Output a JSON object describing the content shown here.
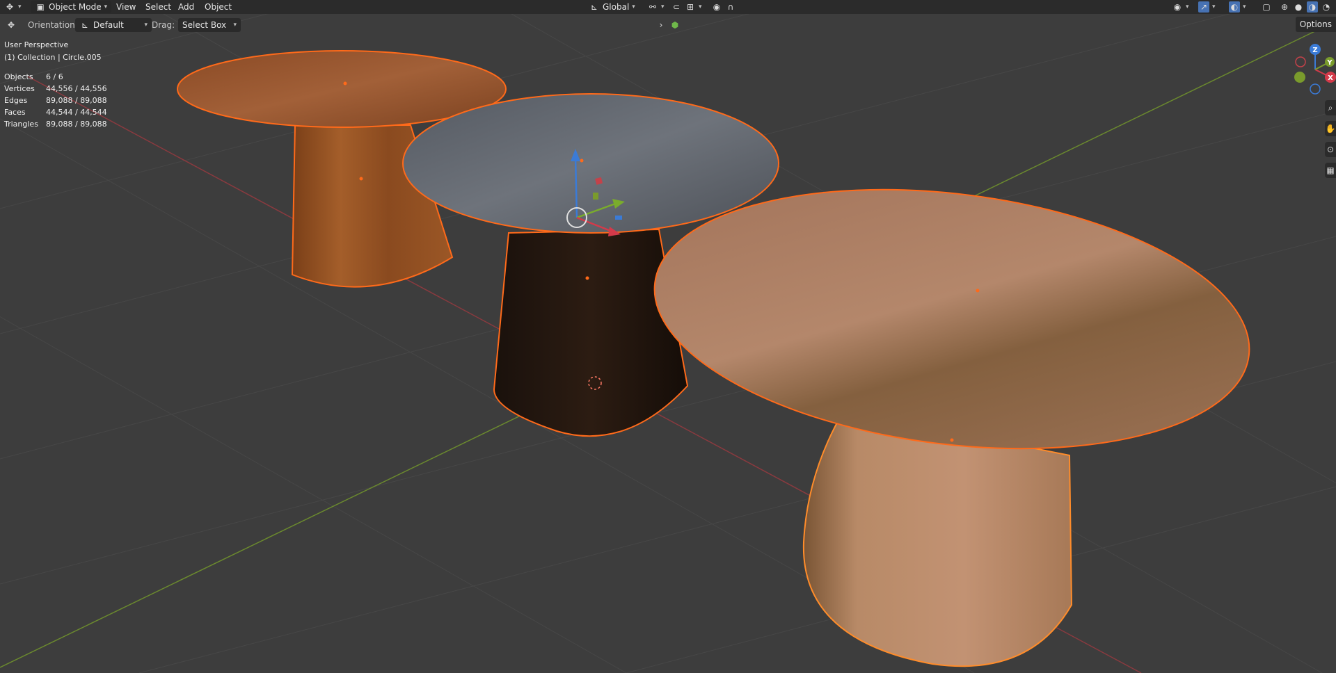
{
  "header": {
    "editor_icon": "move-icon",
    "mode_label": "Object Mode",
    "menus": [
      "View",
      "Select",
      "Add",
      "Object"
    ],
    "transform_orientation": "Global"
  },
  "toolbar": {
    "orientation_label": "Orientation:",
    "orientation_value": "Default",
    "drag_label": "Drag:",
    "drag_value": "Select Box",
    "options_label": "Options"
  },
  "viewport": {
    "perspective": "User Perspective",
    "collection": "(1) Collection | Circle.005",
    "stats": [
      {
        "key": "Objects",
        "value": "6 / 6"
      },
      {
        "key": "Vertices",
        "value": "44,556 / 44,556"
      },
      {
        "key": "Edges",
        "value": "89,088 / 89,088"
      },
      {
        "key": "Faces",
        "value": "44,544 / 44,544"
      },
      {
        "key": "Triangles",
        "value": "89,088 / 89,088"
      }
    ]
  },
  "gizmo": {
    "x": "X",
    "y": "Y",
    "z": "Z"
  },
  "colors": {
    "selection_outline": "#ff6a1a",
    "axis_x": "#c4424a",
    "axis_y": "#7a9b2c",
    "axis_z": "#3b7bd6",
    "background": "#3d3d3d"
  }
}
